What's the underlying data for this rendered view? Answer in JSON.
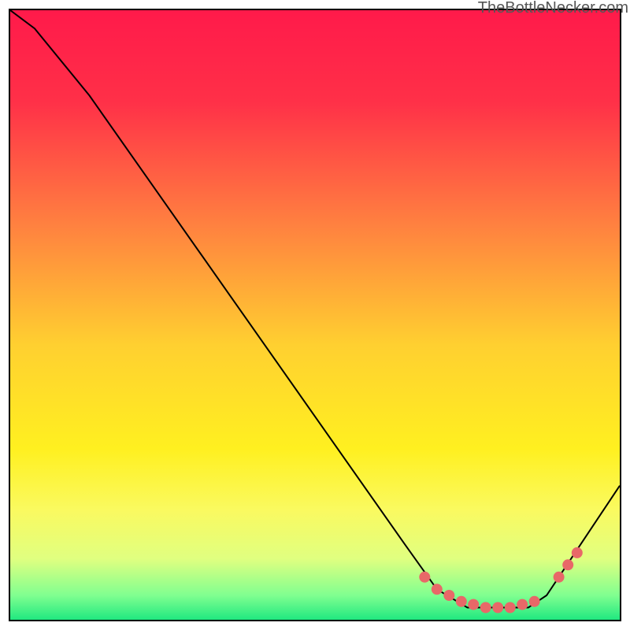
{
  "watermark": "TheBottleNecker.com",
  "chart_data": {
    "type": "line",
    "title": "",
    "xlabel": "",
    "ylabel": "",
    "xlim": [
      0,
      100
    ],
    "ylim": [
      0,
      100
    ],
    "curve_points": [
      {
        "x": 0,
        "y": 100
      },
      {
        "x": 4,
        "y": 97
      },
      {
        "x": 13,
        "y": 86
      },
      {
        "x": 65,
        "y": 12
      },
      {
        "x": 70,
        "y": 5
      },
      {
        "x": 75,
        "y": 2
      },
      {
        "x": 80,
        "y": 2
      },
      {
        "x": 85,
        "y": 2
      },
      {
        "x": 88,
        "y": 4
      },
      {
        "x": 92,
        "y": 10
      },
      {
        "x": 100,
        "y": 22
      }
    ],
    "markers": [
      {
        "x": 68,
        "y": 7
      },
      {
        "x": 70,
        "y": 5
      },
      {
        "x": 72,
        "y": 4
      },
      {
        "x": 74,
        "y": 3
      },
      {
        "x": 76,
        "y": 2.5
      },
      {
        "x": 78,
        "y": 2
      },
      {
        "x": 80,
        "y": 2
      },
      {
        "x": 82,
        "y": 2
      },
      {
        "x": 84,
        "y": 2.5
      },
      {
        "x": 86,
        "y": 3
      },
      {
        "x": 90,
        "y": 7
      },
      {
        "x": 91.5,
        "y": 9
      },
      {
        "x": 93,
        "y": 11
      }
    ],
    "gradient_stops": [
      {
        "pos": 0,
        "color": "#ff1a4a"
      },
      {
        "pos": 0.15,
        "color": "#ff3048"
      },
      {
        "pos": 0.35,
        "color": "#ff8040"
      },
      {
        "pos": 0.55,
        "color": "#ffd030"
      },
      {
        "pos": 0.72,
        "color": "#fff020"
      },
      {
        "pos": 0.82,
        "color": "#fafa60"
      },
      {
        "pos": 0.9,
        "color": "#e0ff80"
      },
      {
        "pos": 0.96,
        "color": "#80ff90"
      },
      {
        "pos": 1.0,
        "color": "#20e880"
      }
    ],
    "marker_color": "#e86868"
  }
}
